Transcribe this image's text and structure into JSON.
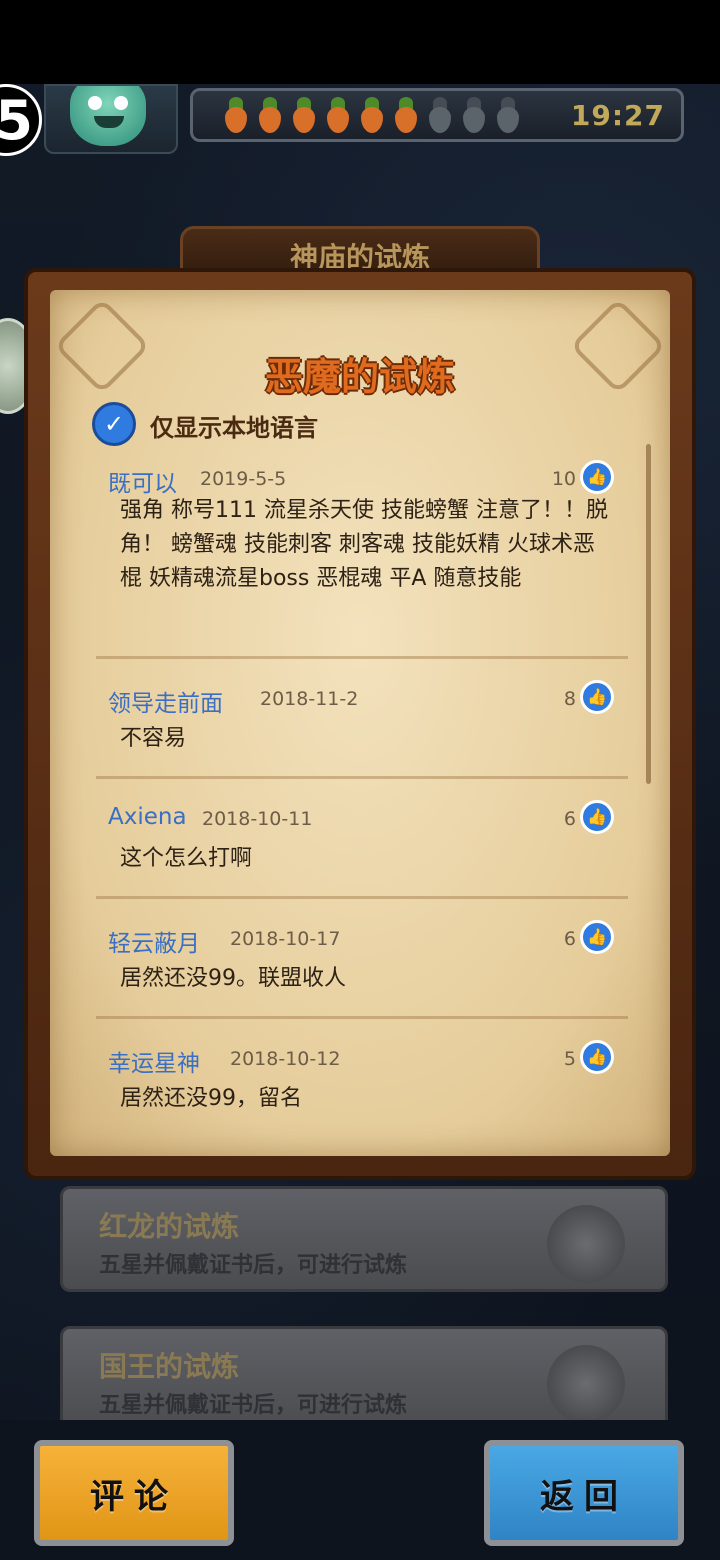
{
  "hud": {
    "level": "5",
    "timer": "19:27",
    "carrots_total": 9,
    "carrots_filled": 6
  },
  "header": {
    "tab_title": "神庙的试炼"
  },
  "panel": {
    "title": "恶魔的试炼",
    "filter_label": "仅显示本地语言",
    "filter_checked": true
  },
  "comments": [
    {
      "user": "既可以",
      "date": "2019-5-5",
      "likes": "10",
      "text": "强角 称号111 流星杀天使 技能螃蟹 注意了！！脱角！ 螃蟹魂 技能刺客 刺客魂 技能妖精 火球术恶棍 妖精魂流星boss 恶棍魂 平A 随意技能"
    },
    {
      "user": "领导走前面",
      "date": "2018-11-2",
      "likes": "8",
      "text": "不容易"
    },
    {
      "user": "Axiena",
      "date": "2018-10-11",
      "likes": "6",
      "text": "这个怎么打啊"
    },
    {
      "user": "轻云蔽月",
      "date": "2018-10-17",
      "likes": "6",
      "text": "居然还没99。联盟收人"
    },
    {
      "user": "幸运星神",
      "date": "2018-10-12",
      "likes": "5",
      "text": "居然还没99，留名"
    }
  ],
  "trials": [
    {
      "title": "红龙的试炼",
      "subtitle": "五星并佩戴证书后，可进行试炼"
    },
    {
      "title": "国王的试炼",
      "subtitle": "五星并佩戴证书后，可进行试炼"
    }
  ],
  "buttons": {
    "comment": "评论",
    "back": "返回"
  },
  "colors": {
    "title_orange": "#e06b1e",
    "username_blue": "#3a6fc4",
    "comment_button": "#f0a42a",
    "back_button": "#3b96d6"
  }
}
